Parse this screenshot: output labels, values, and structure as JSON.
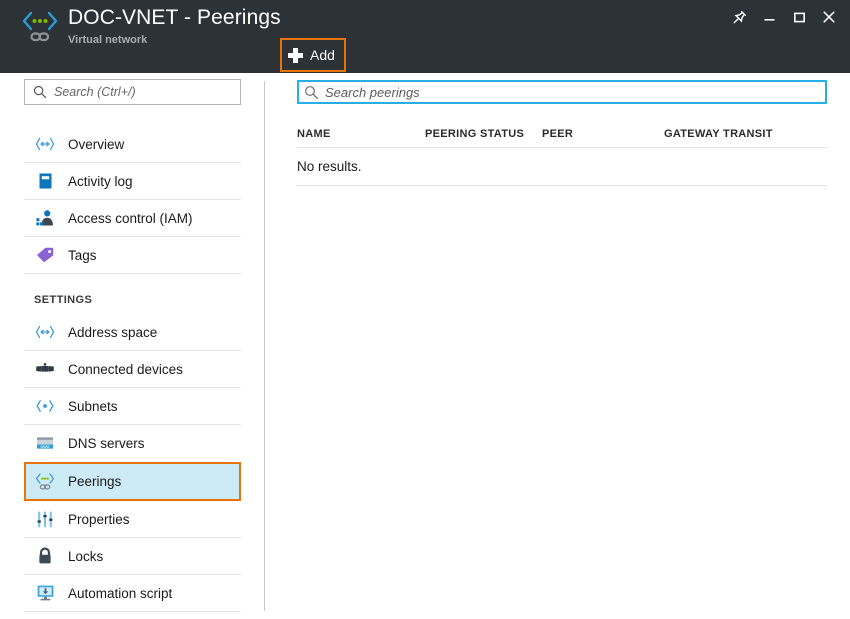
{
  "window": {
    "title": "DOC-VNET - Peerings",
    "subtitle": "Virtual network",
    "resource_icon": "virtual-network-peering-icon",
    "controls": [
      {
        "name": "pin-icon",
        "label": "Pin"
      },
      {
        "name": "minimize-icon",
        "label": "Minimize"
      },
      {
        "name": "maximize-icon",
        "label": "Maximize"
      },
      {
        "name": "close-icon",
        "label": "Close"
      }
    ]
  },
  "toolbar": {
    "add_label": "Add",
    "add_icon": "plus-icon",
    "highlight_color": "#e8730c"
  },
  "sidebar": {
    "search": {
      "placeholder": "Search (Ctrl+/)",
      "value": "",
      "icon": "search-icon"
    },
    "items": [
      {
        "label": "Overview",
        "icon": "virtual-network-icon",
        "selected": false
      },
      {
        "label": "Activity log",
        "icon": "activity-log-icon",
        "selected": false
      },
      {
        "label": "Access control (IAM)",
        "icon": "access-control-icon",
        "selected": false
      },
      {
        "label": "Tags",
        "icon": "tag-icon",
        "selected": false
      }
    ],
    "section_label": "SETTINGS",
    "settings_items": [
      {
        "label": "Address space",
        "icon": "address-space-icon",
        "selected": false
      },
      {
        "label": "Connected devices",
        "icon": "connected-devices-icon",
        "selected": false
      },
      {
        "label": "Subnets",
        "icon": "subnets-icon",
        "selected": false
      },
      {
        "label": "DNS servers",
        "icon": "dns-servers-icon",
        "selected": false
      },
      {
        "label": "Peerings",
        "icon": "peerings-icon",
        "selected": true
      },
      {
        "label": "Properties",
        "icon": "properties-icon",
        "selected": false
      },
      {
        "label": "Locks",
        "icon": "lock-icon",
        "selected": false
      },
      {
        "label": "Automation script",
        "icon": "automation-script-icon",
        "selected": false
      }
    ]
  },
  "main": {
    "search": {
      "placeholder": "Search peerings",
      "value": "",
      "icon": "search-icon",
      "focused": true,
      "focus_color": "#24b0e8"
    },
    "table": {
      "columns": [
        "NAME",
        "PEERING STATUS",
        "PEER",
        "GATEWAY TRANSIT"
      ],
      "rows": [],
      "empty_text": "No results."
    }
  },
  "colors": {
    "header_background": "#2d3236",
    "accent_orange": "#e8730c",
    "selection_blue": "#cdeaf7",
    "focus_blue": "#24b0e8"
  }
}
